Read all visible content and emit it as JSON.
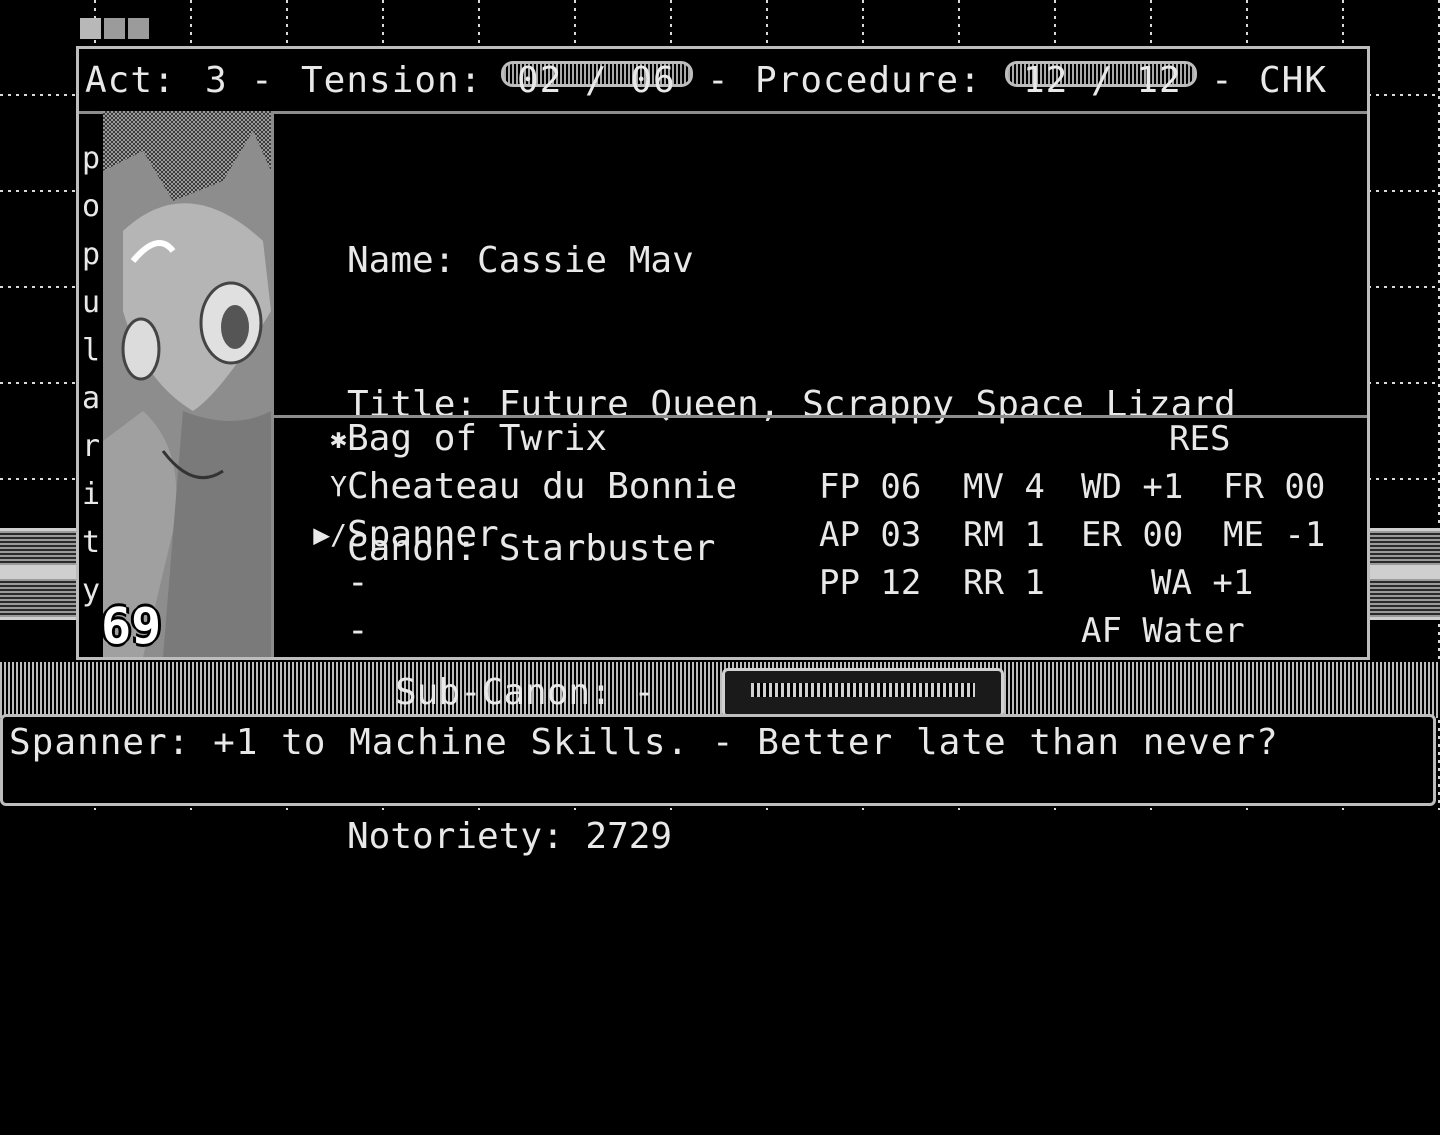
{
  "header": {
    "act_label": "Act:",
    "act_value": "3",
    "sep1": "-",
    "tension_label": "Tension:",
    "tension_value": "02 / 06",
    "sep2": "-",
    "procedure_label": "Procedure:",
    "procedure_value": "12 / 12",
    "sep3": "-",
    "mode": "CHK"
  },
  "popularity": {
    "letters": [
      "p",
      "o",
      "p",
      "u",
      "l",
      "a",
      "r",
      "i",
      "t",
      "y"
    ],
    "value": "69"
  },
  "character": {
    "name_line": "Name: Cassie Mav",
    "title_line": "Title: Future Queen, Scrappy Space Lizard",
    "canon_line": "Canon: Starbuster",
    "subcanon_line": "Sub-Canon: -",
    "notoriety_line": "Notoriety: 2729"
  },
  "items": [
    {
      "icon": "✱",
      "icon_name": "candy-icon",
      "label": "Bag of Twrix",
      "selected": false
    },
    {
      "icon": "Y",
      "icon_name": "goblet-icon",
      "label": "Cheateau du Bonnie",
      "selected": false
    },
    {
      "icon": "▶/",
      "icon_name": "wrench-icon",
      "label": "Spanner",
      "selected": true
    },
    {
      "icon": "",
      "icon_name": "",
      "label": "-",
      "selected": false
    },
    {
      "icon": "",
      "icon_name": "",
      "label": "-",
      "selected": false
    }
  ],
  "stats": {
    "res_label": "RES",
    "fp": "FP 06",
    "mv": "MV 4",
    "wd": "WD +1",
    "fr": "FR 00",
    "ap": "AP 03",
    "rm": "RM 1",
    "er": "ER 00",
    "me": "ME -1",
    "pp": "PP 12",
    "rr": "RR 1",
    "wa": "WA +1",
    "af": "AF Water"
  },
  "message": "Spanner: +1 to Machine Skills. - Better late than never?"
}
